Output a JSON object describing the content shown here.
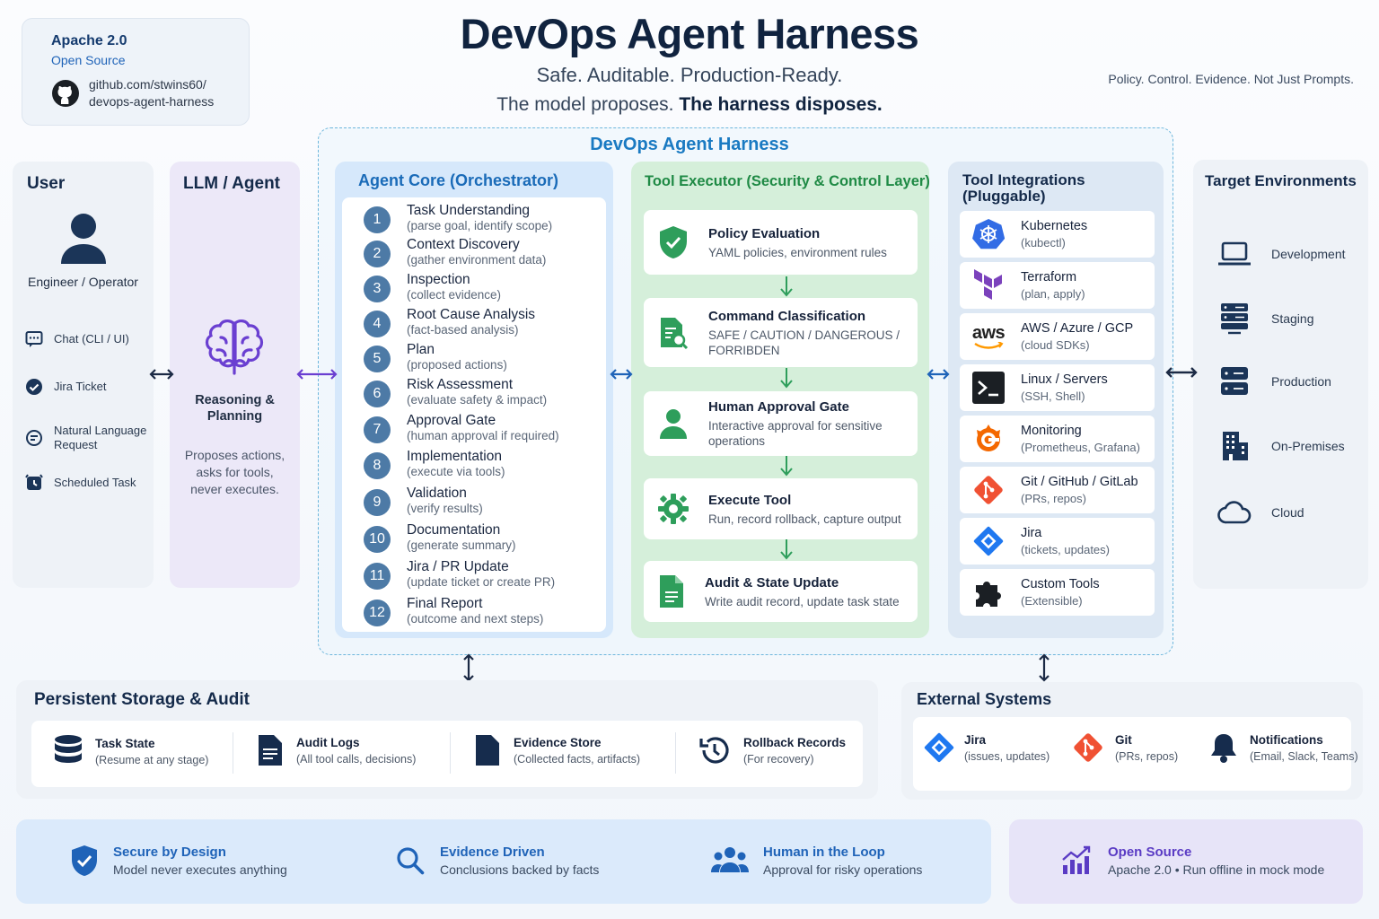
{
  "license": {
    "name": "Apache 2.0",
    "type": "Open Source",
    "repo_line1": "github.com/stwins60/",
    "repo_line2": "devops-agent-harness"
  },
  "header": {
    "title": "DevOps Agent Harness",
    "subtitle": "Safe. Auditable. Production-Ready.",
    "motto_a": "The model proposes.",
    "motto_b": "The harness disposes.",
    "tagline": "Policy. Control. Evidence. Not Just Prompts."
  },
  "harness_title": "DevOps Agent Harness",
  "user": {
    "title": "User",
    "role": "Engineer / Operator",
    "inputs": [
      {
        "label": "Chat (CLI / UI)"
      },
      {
        "label": "Jira Ticket"
      },
      {
        "label": "Natural Language Request"
      },
      {
        "label": "Scheduled Task"
      }
    ]
  },
  "llm": {
    "title": "LLM / Agent",
    "capability": "Reasoning & Planning",
    "note": "Proposes actions, asks for tools, never executes."
  },
  "core": {
    "title": "Agent Core (Orchestrator)",
    "steps": [
      {
        "n": "1",
        "name": "Task Understanding",
        "desc": "(parse goal, identify scope)"
      },
      {
        "n": "2",
        "name": "Context Discovery",
        "desc": "(gather environment data)"
      },
      {
        "n": "3",
        "name": "Inspection",
        "desc": "(collect evidence)"
      },
      {
        "n": "4",
        "name": "Root Cause Analysis",
        "desc": "(fact-based analysis)"
      },
      {
        "n": "5",
        "name": "Plan",
        "desc": "(proposed actions)"
      },
      {
        "n": "6",
        "name": "Risk Assessment",
        "desc": "(evaluate safety & impact)"
      },
      {
        "n": "7",
        "name": "Approval Gate",
        "desc": "(human approval if required)"
      },
      {
        "n": "8",
        "name": "Implementation",
        "desc": "(execute via tools)"
      },
      {
        "n": "9",
        "name": "Validation",
        "desc": "(verify results)"
      },
      {
        "n": "10",
        "name": "Documentation",
        "desc": "(generate summary)"
      },
      {
        "n": "11",
        "name": "Jira / PR Update",
        "desc": "(update ticket or create PR)"
      },
      {
        "n": "12",
        "name": "Final Report",
        "desc": "(outcome and next steps)"
      }
    ]
  },
  "executor": {
    "title": "Tool Executor (Security & Control Layer)",
    "stages": [
      {
        "name": "Policy Evaluation",
        "desc": "YAML policies, environment rules",
        "icon": "shield-check-icon"
      },
      {
        "name": "Command Classification",
        "desc": "SAFE / CAUTION / DANGEROUS / FORRIBDEN",
        "icon": "document-search-icon"
      },
      {
        "name": "Human Approval Gate",
        "desc": "Interactive approval for sensitive operations",
        "icon": "person-icon"
      },
      {
        "name": "Execute Tool",
        "desc": "Run, record rollback, capture output",
        "icon": "gear-icon"
      },
      {
        "name": "Audit & State Update",
        "desc": "Write audit record, update task state",
        "icon": "document-icon"
      }
    ]
  },
  "tools": {
    "title_line1": "Tool Integrations",
    "title_line2": "(Pluggable)",
    "items": [
      {
        "name": "Kubernetes",
        "desc": "(kubectl)"
      },
      {
        "name": "Terraform",
        "desc": "(plan, apply)"
      },
      {
        "name": "AWS / Azure / GCP",
        "desc": "(cloud SDKs)",
        "logo_text": "aws"
      },
      {
        "name": "Linux / Servers",
        "desc": "(SSH, Shell)"
      },
      {
        "name": "Monitoring",
        "desc": "(Prometheus, Grafana)"
      },
      {
        "name": "Git / GitHub / GitLab",
        "desc": "(PRs, repos)"
      },
      {
        "name": "Jira",
        "desc": "(tickets, updates)"
      },
      {
        "name": "Custom Tools",
        "desc": "(Extensible)"
      }
    ]
  },
  "environments": {
    "title": "Target Environments",
    "items": [
      {
        "label": "Development"
      },
      {
        "label": "Staging"
      },
      {
        "label": "Production"
      },
      {
        "label": "On-Premises"
      },
      {
        "label": "Cloud"
      }
    ]
  },
  "storage": {
    "title": "Persistent Storage & Audit",
    "items": [
      {
        "name": "Task State",
        "desc": "(Resume at any stage)"
      },
      {
        "name": "Audit Logs",
        "desc": "(All tool calls, decisions)"
      },
      {
        "name": "Evidence Store",
        "desc": "(Collected facts, artifacts)"
      },
      {
        "name": "Rollback Records",
        "desc": "(For recovery)"
      }
    ]
  },
  "external": {
    "title": "External Systems",
    "items": [
      {
        "name": "Jira",
        "desc": "(issues, updates)"
      },
      {
        "name": "Git",
        "desc": "(PRs, repos)"
      },
      {
        "name": "Notifications",
        "desc": "(Email, Slack, Teams)"
      }
    ]
  },
  "footer": {
    "items": [
      {
        "name": "Secure by Design",
        "desc": "Model never executes anything"
      },
      {
        "name": "Evidence Driven",
        "desc": "Conclusions backed by facts"
      },
      {
        "name": "Human in the Loop",
        "desc": "Approval for risky operations"
      },
      {
        "name": "Open Source",
        "desc": "Apache 2.0 • Run offline in mock mode"
      }
    ]
  },
  "colors": {
    "core_step_circle": "#4d7aa6",
    "executor_icon": "#2e9e5b",
    "harness_title": "#1a7ac2",
    "footer_link": "#1f63b8",
    "open_source_purple": "#5a3bc4"
  }
}
